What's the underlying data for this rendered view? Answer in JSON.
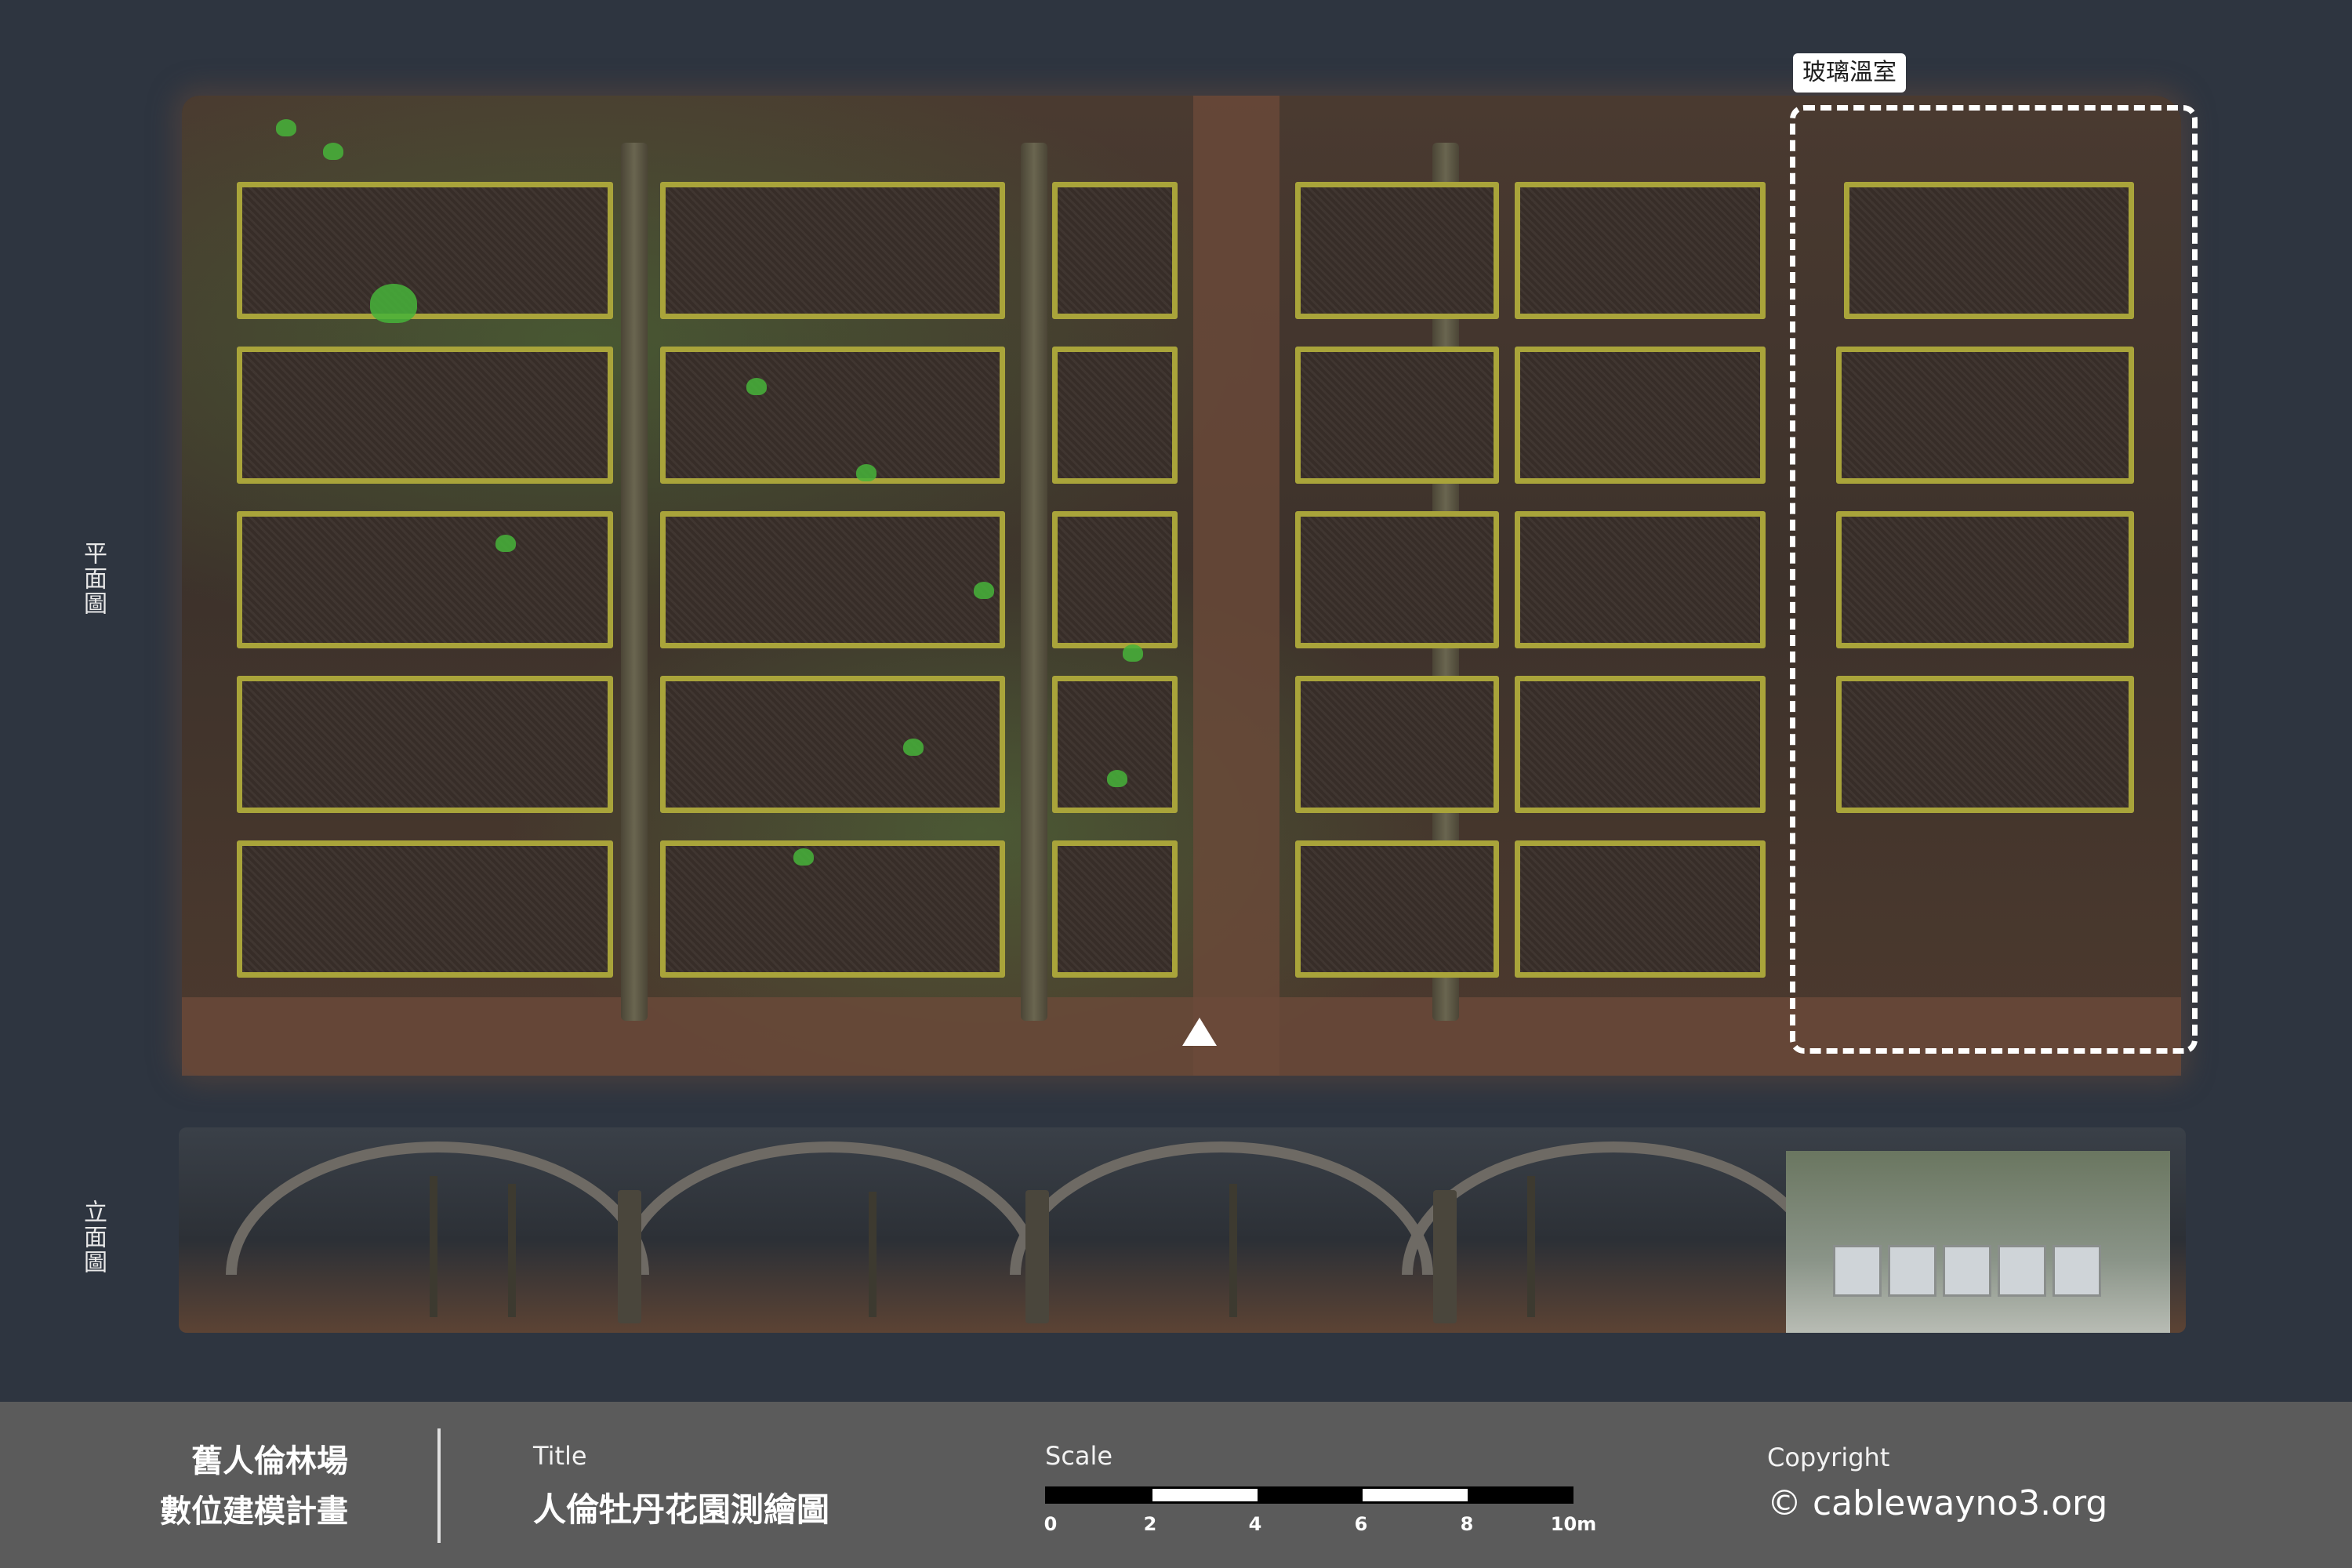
{
  "labels": {
    "plan": "平面圖",
    "elevation": "立面圖",
    "greenhouse": "玻璃溫室"
  },
  "footer": {
    "project_line1": "舊人倫林場",
    "project_line2": "數位建模計畫",
    "title_caption": "Title",
    "title_value": "人倫牡丹花園測繪圖",
    "scale_caption": "Scale",
    "scale_ticks": [
      "0",
      "2",
      "4",
      "6",
      "8",
      "10m"
    ],
    "copyright_caption": "Copyright",
    "copyright_value": "© cablewayno3.org"
  },
  "colors": {
    "background": "#2e3540",
    "footer": "#5b5b5b",
    "bed_border": "#a9a43a",
    "greenhouse_outline": "#ffffff"
  }
}
